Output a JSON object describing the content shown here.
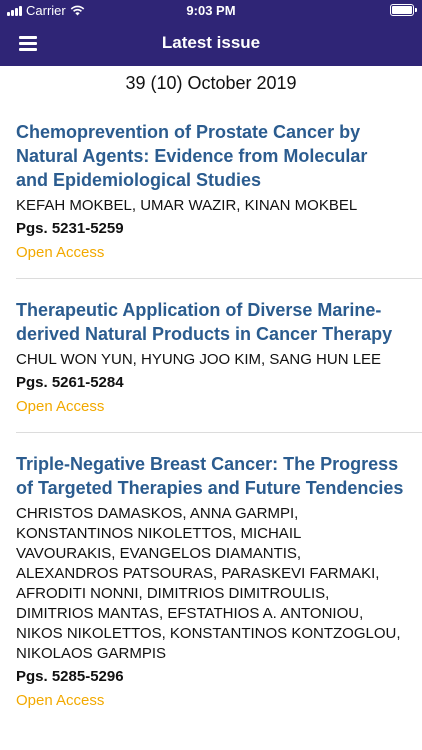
{
  "status_bar": {
    "carrier": "Carrier",
    "time": "9:03 PM"
  },
  "nav": {
    "title": "Latest issue",
    "menu_icon": "hamburger-menu-icon"
  },
  "issue": {
    "label": "39 (10) October 2019"
  },
  "articles": [
    {
      "title": "Chemoprevention of Prostate Cancer by Natural Agents: Evidence from Molecular and Epidemiological Studies",
      "authors": "KEFAH MOKBEL, UMAR WAZIR, KINAN MOKBEL",
      "pages": "Pgs. 5231-5259",
      "access": "Open Access"
    },
    {
      "title": "Therapeutic Application of Diverse Marine-derived Natural Products in Cancer Therapy",
      "authors": "CHUL WON YUN, HYUNG JOO KIM, SANG HUN LEE",
      "pages": "Pgs. 5261-5284",
      "access": "Open Access"
    },
    {
      "title": "Triple-Negative Breast Cancer: The Progress of Targeted Therapies and Future Tendencies",
      "authors": "CHRISTOS DAMASKOS, ANNA GARMPI, KONSTANTINOS NIKOLETTOS, MICHAIL VAVOURAKIS, EVANGELOS DIAMANTIS, ALEXANDROS PATSOURAS, PARASKEVI FARMAKI, AFRODITI NONNI, DIMITRIOS DIMITROULIS, DIMITRIOS MANTAS, EFSTATHIOS A. ANTONIOU, NIKOS NIKOLETTOS, KONSTANTINOS KONTZOGLOU, NIKOLAOS GARMPIS",
      "pages": "Pgs. 5285-5296",
      "access": "Open Access"
    }
  ],
  "colors": {
    "bar_background": "#2f2576",
    "title_blue": "#2b5c8f",
    "open_access": "#f2a900"
  }
}
